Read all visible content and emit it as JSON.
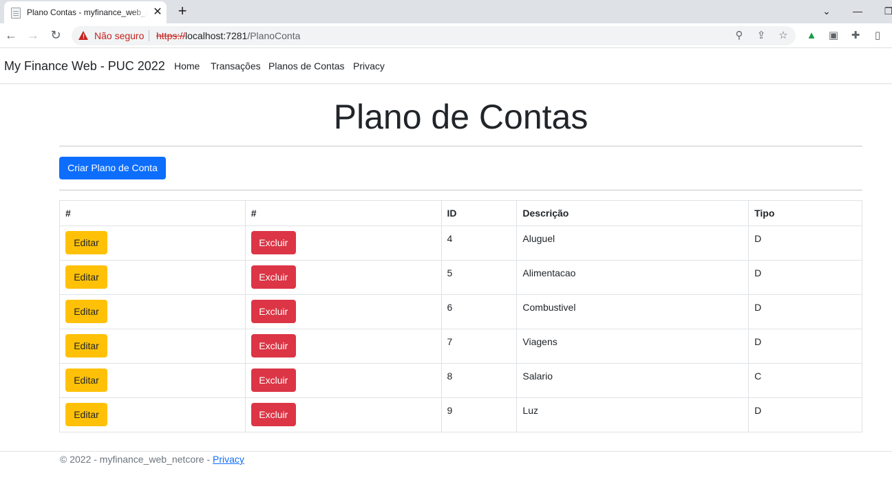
{
  "browser": {
    "tab_title": "Plano Contas - myfinance_web_netcore",
    "new_tab": "+",
    "close_tab": "✕",
    "minimize": "—",
    "chevron": "⌄",
    "maximize": "❐",
    "security_text": "Não seguro",
    "url_scheme": "https://",
    "url_host": "localhost:7281",
    "url_path": "/PlanoConta"
  },
  "app": {
    "brand": "My Finance Web - PUC 2022",
    "nav": [
      "Home",
      "Transações",
      "Planos de Contas",
      "Privacy"
    ]
  },
  "main": {
    "title": "Plano de Contas",
    "create_button": "Criar Plano de Conta",
    "table": {
      "headers": [
        "#",
        "#",
        "ID",
        "Descrição",
        "Tipo"
      ],
      "rows": [
        {
          "edit": "Editar",
          "delete": "Excluir",
          "id": "4",
          "descricao": "Aluguel",
          "tipo": "D"
        },
        {
          "edit": "Editar",
          "delete": "Excluir",
          "id": "5",
          "descricao": "Alimentacao",
          "tipo": "D"
        },
        {
          "edit": "Editar",
          "delete": "Excluir",
          "id": "6",
          "descricao": "Combustivel",
          "tipo": "D"
        },
        {
          "edit": "Editar",
          "delete": "Excluir",
          "id": "7",
          "descricao": "Viagens",
          "tipo": "D"
        },
        {
          "edit": "Editar",
          "delete": "Excluir",
          "id": "8",
          "descricao": "Salario",
          "tipo": "C"
        },
        {
          "edit": "Editar",
          "delete": "Excluir",
          "id": "9",
          "descricao": "Luz",
          "tipo": "D"
        }
      ]
    }
  },
  "footer": {
    "text": "© 2022 - myfinance_web_netcore - ",
    "link": "Privacy"
  },
  "colors": {
    "primary": "#0d6efd",
    "warning": "#ffc107",
    "danger": "#dc3545"
  }
}
